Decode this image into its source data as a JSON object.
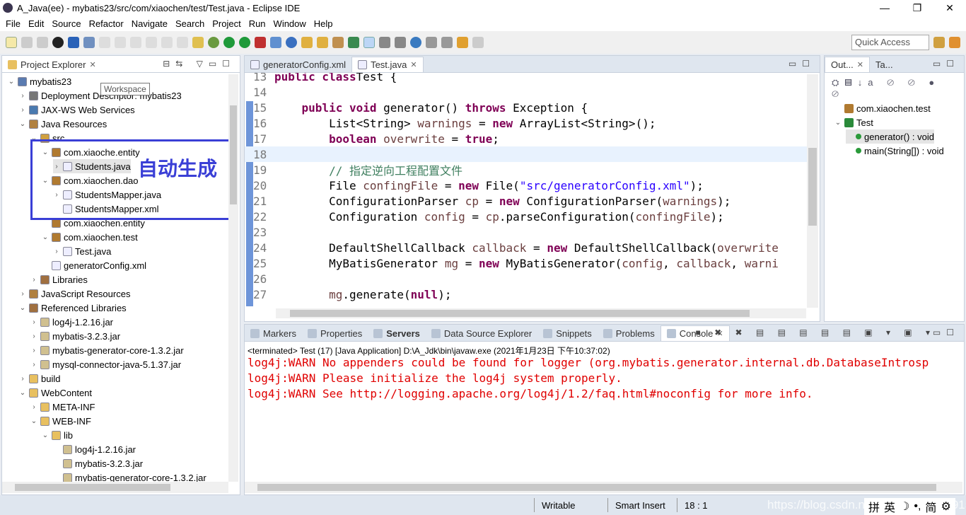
{
  "window": {
    "title": "A_Java(ee) - mybatis23/src/com/xiaochen/test/Test.java - Eclipse IDE",
    "minimize": "—",
    "maximize": "❐",
    "close": "✕"
  },
  "menu": [
    "File",
    "Edit",
    "Source",
    "Refactor",
    "Navigate",
    "Search",
    "Project",
    "Run",
    "Window",
    "Help"
  ],
  "toolbar": {
    "quick_access_placeholder": "Quick Access"
  },
  "project_explorer": {
    "tab": "Project Explorer",
    "tooltip": "Workspace",
    "annotation": "自动生成",
    "annotation_color": "#3a3fd6",
    "items": [
      {
        "label": "mybatis23",
        "depth": 0,
        "tw": "⌄",
        "icon": "project-icon"
      },
      {
        "label": "Deployment Descriptor: mybatis23",
        "depth": 1,
        "tw": "›",
        "icon": "deployment-icon"
      },
      {
        "label": "JAX-WS Web Services",
        "depth": 1,
        "tw": "›",
        "icon": "webservice-icon"
      },
      {
        "label": "Java Resources",
        "depth": 1,
        "tw": "⌄",
        "icon": "java-resources-icon"
      },
      {
        "label": "src",
        "depth": 2,
        "tw": "⌄",
        "icon": "source-folder-icon"
      },
      {
        "label": "com.xiaoche.entity",
        "depth": 3,
        "tw": "⌄",
        "icon": "package-icon"
      },
      {
        "label": "Students.java",
        "depth": 4,
        "tw": "›",
        "icon": "java-file-icon",
        "selected": true
      },
      {
        "label": "com.xiaochen.dao",
        "depth": 3,
        "tw": "⌄",
        "icon": "package-icon"
      },
      {
        "label": "StudentsMapper.java",
        "depth": 4,
        "tw": "›",
        "icon": "java-file-icon"
      },
      {
        "label": "StudentsMapper.xml",
        "depth": 4,
        "tw": "",
        "icon": "xml-file-icon"
      },
      {
        "label": "com.xiaochen.entity",
        "depth": 3,
        "tw": "",
        "icon": "package-icon"
      },
      {
        "label": "com.xiaochen.test",
        "depth": 3,
        "tw": "⌄",
        "icon": "package-icon"
      },
      {
        "label": "Test.java",
        "depth": 4,
        "tw": "›",
        "icon": "java-file-icon"
      },
      {
        "label": "generatorConfig.xml",
        "depth": 3,
        "tw": "",
        "icon": "xml-file-icon"
      },
      {
        "label": "Libraries",
        "depth": 2,
        "tw": "›",
        "icon": "library-icon"
      },
      {
        "label": "JavaScript Resources",
        "depth": 1,
        "tw": "›",
        "icon": "js-resources-icon"
      },
      {
        "label": "Referenced Libraries",
        "depth": 1,
        "tw": "⌄",
        "icon": "library-icon"
      },
      {
        "label": "log4j-1.2.16.jar",
        "depth": 2,
        "tw": "›",
        "icon": "jar-icon"
      },
      {
        "label": "mybatis-3.2.3.jar",
        "depth": 2,
        "tw": "›",
        "icon": "jar-icon"
      },
      {
        "label": "mybatis-generator-core-1.3.2.jar",
        "depth": 2,
        "tw": "›",
        "icon": "jar-icon"
      },
      {
        "label": "mysql-connector-java-5.1.37.jar",
        "depth": 2,
        "tw": "›",
        "icon": "jar-icon"
      },
      {
        "label": "build",
        "depth": 1,
        "tw": "›",
        "icon": "folder-icon"
      },
      {
        "label": "WebContent",
        "depth": 1,
        "tw": "⌄",
        "icon": "folder-icon"
      },
      {
        "label": "META-INF",
        "depth": 2,
        "tw": "›",
        "icon": "folder-icon"
      },
      {
        "label": "WEB-INF",
        "depth": 2,
        "tw": "⌄",
        "icon": "folder-icon"
      },
      {
        "label": "lib",
        "depth": 3,
        "tw": "⌄",
        "icon": "folder-icon"
      },
      {
        "label": "log4j-1.2.16.jar",
        "depth": 4,
        "tw": "",
        "icon": "jar-icon"
      },
      {
        "label": "mybatis-3.2.3.jar",
        "depth": 4,
        "tw": "",
        "icon": "jar-icon"
      },
      {
        "label": "mybatis-generator-core-1.3.2.jar",
        "depth": 4,
        "tw": "",
        "icon": "jar-icon"
      }
    ]
  },
  "editor": {
    "tabs": [
      {
        "label": "generatorConfig.xml",
        "active": false
      },
      {
        "label": "Test.java",
        "active": true
      }
    ],
    "lines": [
      {
        "n": "13",
        "html": [
          [
            "kw",
            "public class"
          ],
          [
            "",
            "Test {"
          ]
        ]
      },
      {
        "n": "14",
        "html": []
      },
      {
        "n": "15",
        "html": [
          [
            "",
            "    "
          ],
          [
            "kw",
            "public void"
          ],
          [
            "",
            " generator() "
          ],
          [
            "kw",
            "throws"
          ],
          [
            "",
            " Exception {"
          ]
        ]
      },
      {
        "n": "16",
        "html": [
          [
            "",
            "        List<String> "
          ],
          [
            "var",
            "warnings"
          ],
          [
            "",
            " = "
          ],
          [
            "kw",
            "new"
          ],
          [
            "",
            " ArrayList<String>();"
          ]
        ]
      },
      {
        "n": "17",
        "html": [
          [
            "",
            "        "
          ],
          [
            "kw",
            "boolean"
          ],
          [
            "var",
            " overwrite"
          ],
          [
            "",
            " = "
          ],
          [
            "kw",
            "true"
          ],
          [
            "",
            ";"
          ]
        ]
      },
      {
        "n": "18",
        "html": [],
        "current": true
      },
      {
        "n": "19",
        "html": [
          [
            "cm",
            "        // 指定逆向工程配置文件"
          ]
        ]
      },
      {
        "n": "20",
        "html": [
          [
            "",
            "        File "
          ],
          [
            "var",
            "confingFile"
          ],
          [
            "",
            " = "
          ],
          [
            "kw",
            "new"
          ],
          [
            "",
            " File("
          ],
          [
            "str",
            "\"src/generatorConfig.xml\""
          ],
          [
            "",
            ");"
          ]
        ]
      },
      {
        "n": "21",
        "html": [
          [
            "",
            "        ConfigurationParser "
          ],
          [
            "var",
            "cp"
          ],
          [
            "",
            " = "
          ],
          [
            "kw",
            "new"
          ],
          [
            "",
            " ConfigurationParser("
          ],
          [
            "var",
            "warnings"
          ],
          [
            "",
            ");"
          ]
        ]
      },
      {
        "n": "22",
        "html": [
          [
            "",
            "        Configuration "
          ],
          [
            "var",
            "config"
          ],
          [
            "",
            " = "
          ],
          [
            "var",
            "cp"
          ],
          [
            "",
            ".parseConfiguration("
          ],
          [
            "var",
            "confingFile"
          ],
          [
            "",
            ");"
          ]
        ]
      },
      {
        "n": "23",
        "html": []
      },
      {
        "n": "24",
        "html": [
          [
            "",
            "        DefaultShellCallback "
          ],
          [
            "var",
            "callback"
          ],
          [
            "",
            " = "
          ],
          [
            "kw",
            "new"
          ],
          [
            "",
            " DefaultShellCallback("
          ],
          [
            "var",
            "overwrite"
          ]
        ]
      },
      {
        "n": "25",
        "html": [
          [
            "",
            "        MyBatisGenerator "
          ],
          [
            "var",
            "mg"
          ],
          [
            "",
            " = "
          ],
          [
            "kw",
            "new"
          ],
          [
            "",
            " MyBatisGenerator("
          ],
          [
            "var",
            "config"
          ],
          [
            "",
            ", "
          ],
          [
            "var",
            "callback"
          ],
          [
            "",
            ", "
          ],
          [
            "var",
            "warni"
          ]
        ]
      },
      {
        "n": "26",
        "html": []
      },
      {
        "n": "27",
        "html": [
          [
            "",
            "        "
          ],
          [
            "var",
            "mg"
          ],
          [
            "",
            ".generate("
          ],
          [
            "kw",
            "null"
          ],
          [
            "",
            ");"
          ]
        ]
      }
    ]
  },
  "outline": {
    "tabs": [
      "Out...",
      "Ta..."
    ],
    "items": [
      {
        "label": "com.xiaochen.test",
        "depth": 0,
        "icon": "package-icon"
      },
      {
        "label": "Test",
        "depth": 0,
        "icon": "class-icon",
        "tw": "⌄"
      },
      {
        "label": "generator() : void",
        "depth": 1,
        "icon": "public-method-icon",
        "selected": true
      },
      {
        "label": "main(String[]) : void",
        "depth": 1,
        "icon": "static-method-icon"
      }
    ]
  },
  "console": {
    "tabs": [
      "Markers",
      "Properties",
      "Servers",
      "Data Source Explorer",
      "Snippets",
      "Problems",
      "Console"
    ],
    "header": "<terminated> Test (17) [Java Application] D:\\A_Jdk\\bin\\javaw.exe (2021年1月23日 下午10:37:02)",
    "lines": [
      "log4j:WARN No appenders could be found for logger (org.mybatis.generator.internal.db.DatabaseIntrosp",
      "log4j:WARN Please initialize the log4j system properly.",
      "log4j:WARN See http://logging.apache.org/log4j/1.2/faq.html#noconfig for more info."
    ]
  },
  "status": {
    "writable": "Writable",
    "insert_mode": "Smart Insert",
    "position": "18 : 1",
    "watermark": "https://blog.csdn.net/weixin_45673915",
    "ime": [
      "拼",
      "英",
      "☽",
      "•,",
      "简",
      "⚙"
    ]
  }
}
